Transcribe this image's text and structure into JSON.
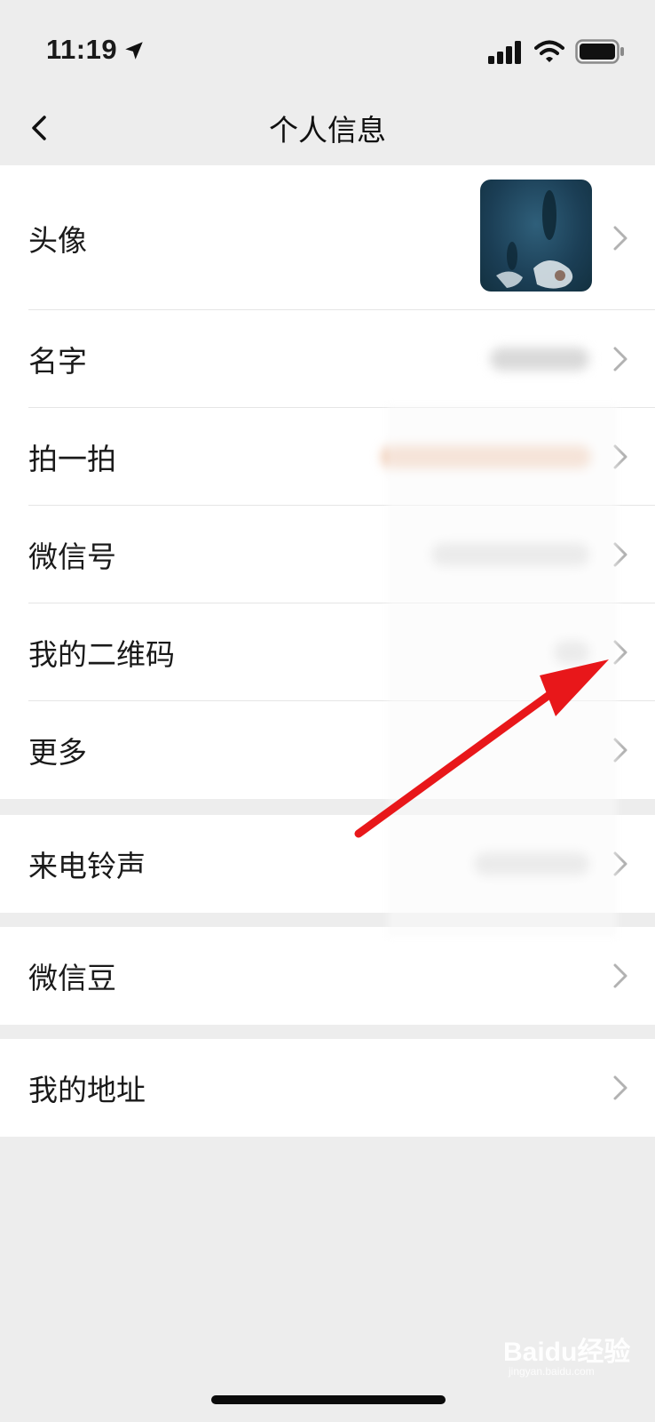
{
  "status_bar": {
    "time": "11:19",
    "icons": [
      "location-arrow-icon",
      "cellular-signal-icon",
      "wifi-icon",
      "battery-icon"
    ]
  },
  "nav": {
    "title": "个人信息",
    "back_icon": "chevron-left-icon"
  },
  "groups": [
    {
      "rows": [
        {
          "label": "头像",
          "value_type": "avatar-image"
        },
        {
          "label": "名字",
          "value_type": "blurred"
        },
        {
          "label": "拍一拍",
          "value_type": "blurred"
        },
        {
          "label": "微信号",
          "value_type": "blurred"
        },
        {
          "label": "我的二维码",
          "value_type": "blurred"
        },
        {
          "label": "更多",
          "value_type": "none"
        }
      ]
    },
    {
      "rows": [
        {
          "label": "来电铃声",
          "value_type": "blurred"
        }
      ]
    },
    {
      "rows": [
        {
          "label": "微信豆",
          "value_type": "none"
        }
      ]
    },
    {
      "rows": [
        {
          "label": "我的地址",
          "value_type": "none"
        }
      ]
    }
  ],
  "annotation": {
    "icon": "red-arrow-icon",
    "color": "#e8171a"
  },
  "watermark": {
    "brand": "Baidu经验",
    "sub": "jingyan.baidu.com"
  },
  "colors": {
    "background": "#ededed",
    "cell": "#ffffff",
    "divider": "#e5e5e5",
    "chevron": "#b2b2b2"
  }
}
